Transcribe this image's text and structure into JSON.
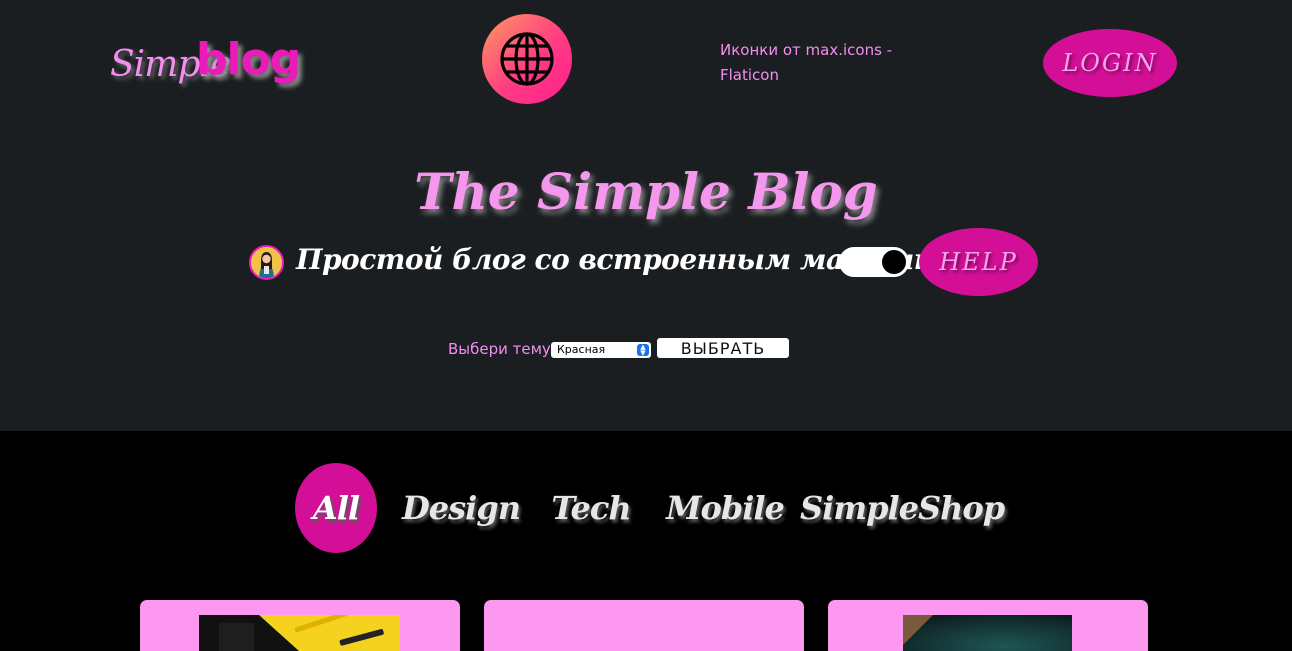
{
  "header": {
    "logo": {
      "part1": "Simple",
      "part2": "blog"
    },
    "credit": "Иконки от max.icons - Flaticon",
    "login_label": "LOGIN"
  },
  "hero": {
    "title": "The Simple Blog",
    "tagline": "Простой блог со встроенным магазинном!",
    "help_label": "HELP",
    "theme": {
      "label": "Выбери тему",
      "selected": "Красная",
      "button_label": "ВЫБРАТЬ"
    }
  },
  "tabs": [
    {
      "label": "All",
      "active": true
    },
    {
      "label": "Design",
      "active": false
    },
    {
      "label": "Tech",
      "active": false
    },
    {
      "label": "Mobile",
      "active": false
    },
    {
      "label": "SimpleShop",
      "active": false
    }
  ],
  "colors": {
    "accent": "#d40f97",
    "pink_text": "#f48df0",
    "card_bg": "#fc98f0",
    "hero_bg": "#1b1e21"
  },
  "icons": {
    "globe": "globe-icon",
    "avatar": "avatar-icon"
  }
}
